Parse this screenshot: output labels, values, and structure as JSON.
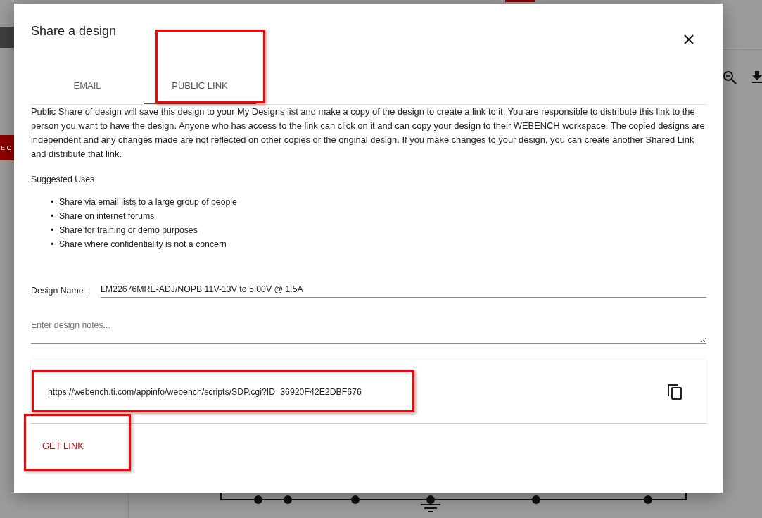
{
  "background": {
    "side_button": "E O"
  },
  "dialog": {
    "title": "Share a design",
    "tabs": [
      {
        "label": "EMAIL",
        "selected": false,
        "highlighted": false
      },
      {
        "label": "PUBLIC LINK",
        "selected": true,
        "highlighted": true
      }
    ],
    "description": "Public Share of design will save this design to your My Designs list and make a copy of the design to create a link to it. You are responsible to distribute this link to the person you want to have the design. Anyone who has access to the link can click on it and can copy your design to their WEBENCH workspace. The copied designs are independent and any changes made are not reflected on other copies or the original design. If you make changes to your design, you can create another Shared Link and distribute that link.",
    "suggested_uses": {
      "heading": "Suggested Uses",
      "bullet": "•",
      "items": [
        "Share via email lists to a large group of people",
        "Share on internet forums",
        "Share for training or demo purposes",
        "Share where confidentiality is not a concern"
      ]
    },
    "design_name": {
      "label": "Design Name :",
      "value": "LM22676MRE-ADJ/NOPB 11V-13V to 5.00V @ 1.5A"
    },
    "notes": {
      "placeholder": "Enter design notes..."
    },
    "link": {
      "url": "https://webench.ti.com/appinfo/webench/scripts/SDP.cgi?ID=36920F42E2DBF676",
      "highlighted": true
    },
    "get_link": {
      "label": "GET LINK",
      "highlighted": true
    }
  }
}
